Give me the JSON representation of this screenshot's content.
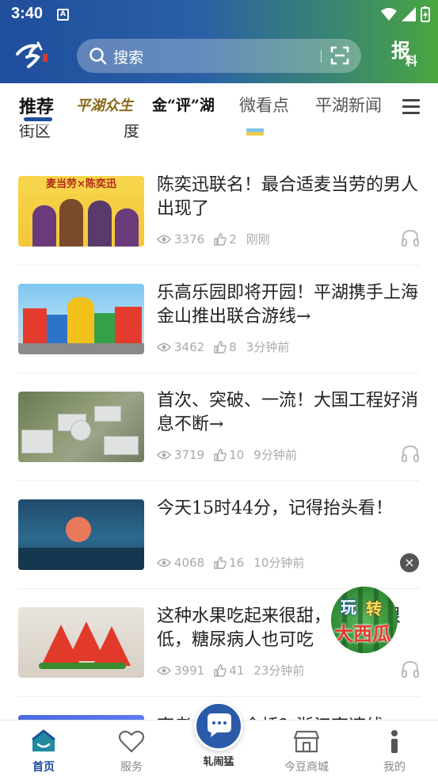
{
  "status_bar": {
    "time": "3:40",
    "notification_icon": "A"
  },
  "header": {
    "search_placeholder": "搜索",
    "report_line1": "报",
    "report_line2": "料"
  },
  "tabs": [
    {
      "label": "推荐",
      "active": true
    },
    {
      "label": "平湖众生",
      "active": false
    },
    {
      "label": "金“评”湖",
      "active": false
    },
    {
      "label": "微看点",
      "active": false
    },
    {
      "label": "平湖新闻",
      "active": false
    }
  ],
  "clipped_row": {
    "text_left": "街区",
    "text_mid": "度"
  },
  "articles": [
    {
      "title": "陈奕迅联名！最合适麦当劳的男人出现了",
      "views": "3376",
      "likes": "2",
      "time": "刚刚",
      "thumb_caption": "麦当劳×陈奕迅",
      "has_audio": true
    },
    {
      "title": "乐高乐园即将开园！平湖携手上海金山推出联合游线→",
      "views": "3462",
      "likes": "8",
      "time": "3分钟前",
      "has_audio": false
    },
    {
      "title": "首次、突破、一流！大国工程好消息不断→",
      "views": "3719",
      "likes": "10",
      "time": "9分钟前",
      "has_audio": true
    },
    {
      "title": "今天15时44分，记得抬头看！",
      "views": "4068",
      "likes": "16",
      "time": "10分钟前",
      "has_audio": false
    },
    {
      "title": "这种水果吃起来很甜，负荷却很低，糖尿病人也可吃",
      "views": "3991",
      "likes": "41",
      "time": "23分钟前",
      "has_audio": true
    }
  ],
  "partial_article": {
    "title": "高考……五金桥？浙江高速线"
  },
  "floating_badge": {
    "line1a": "玩",
    "line1b": "转",
    "line2": "大西瓜",
    "close": "×"
  },
  "bottom_nav": [
    {
      "label": "首页",
      "icon": "home-icon",
      "active": true
    },
    {
      "label": "服务",
      "icon": "heart-icon",
      "active": false
    },
    {
      "label": "轧闹猛",
      "icon": "chat-bubble-icon",
      "active": false
    },
    {
      "label": "今豆商城",
      "icon": "store-icon",
      "active": false
    },
    {
      "label": "我的",
      "icon": "person-icon",
      "active": false
    }
  ],
  "colors": {
    "brand_blue": "#1f4e9c",
    "brand_green": "#4aa640",
    "meta_gray": "#aaaaaa"
  }
}
